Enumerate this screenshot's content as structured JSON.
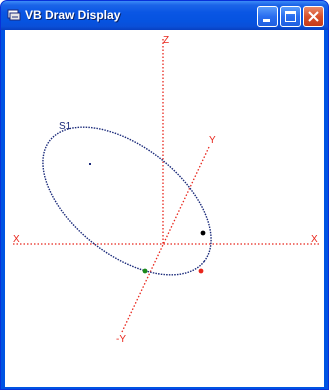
{
  "window": {
    "title": "VB Draw Display",
    "buttons": {
      "minimize": "minimize-icon",
      "maximize": "maximize-icon",
      "close": "close-icon"
    }
  },
  "canvas": {
    "axis_labels": {
      "z": "Z",
      "y": "Y",
      "neg_y": "-Y",
      "x_left": "X",
      "x_right": "X"
    },
    "curve_label": "S1",
    "colors": {
      "axis": "#e8261c",
      "curve": "#1a2a7a",
      "title_bar": "#0a56e4",
      "marker_black": "#000000",
      "marker_green": "#1a8a1a",
      "marker_red": "#e8261c"
    }
  }
}
